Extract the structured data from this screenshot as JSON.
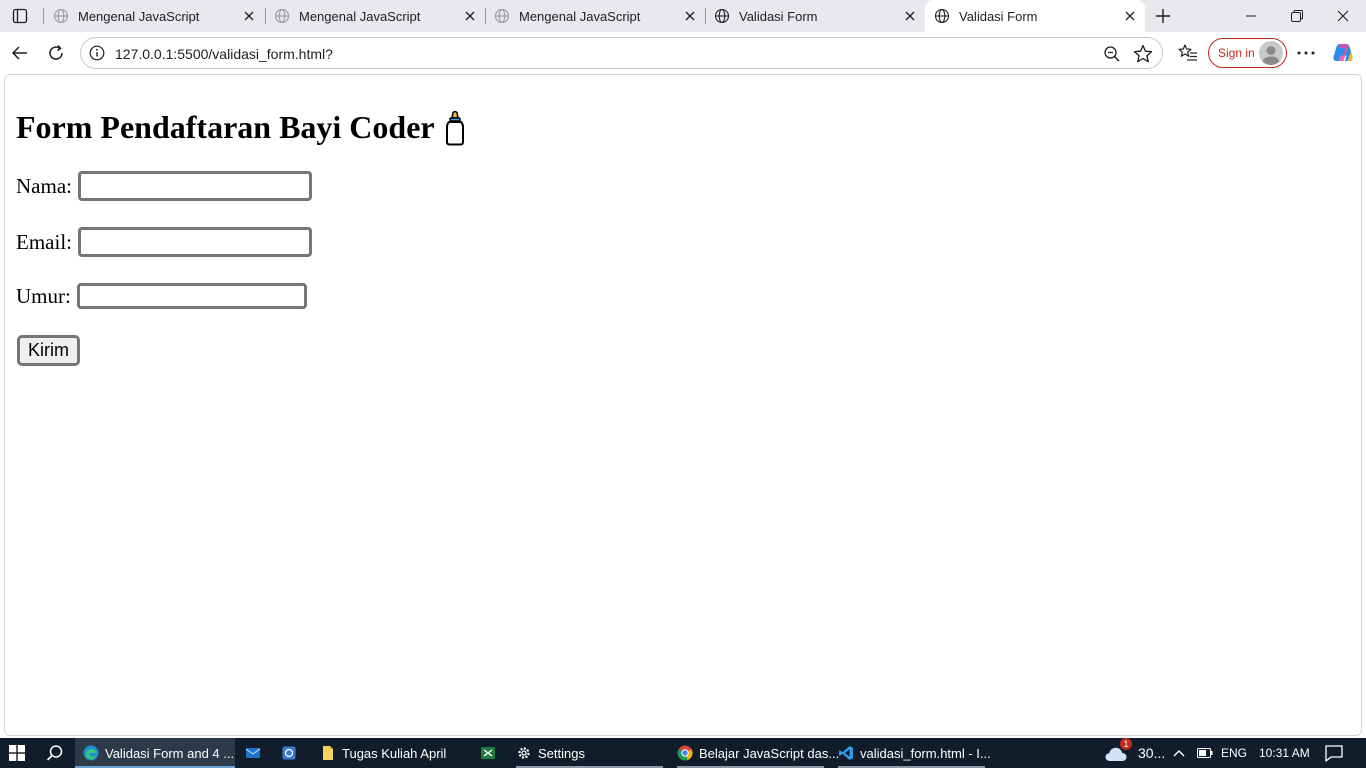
{
  "browser": {
    "tabs": [
      {
        "title": "Mengenal JavaScript",
        "active": false,
        "favicon": "globe-icon"
      },
      {
        "title": "Mengenal JavaScript",
        "active": false,
        "favicon": "globe-icon"
      },
      {
        "title": "Mengenal JavaScript",
        "active": false,
        "favicon": "globe-icon"
      },
      {
        "title": "Validasi Form",
        "active": false,
        "favicon": "globe-icon"
      },
      {
        "title": "Validasi Form",
        "active": true,
        "favicon": "globe-icon"
      }
    ],
    "address": {
      "url": "127.0.0.1:5500/validasi_form.html?"
    },
    "signin_label": "Sign in"
  },
  "page": {
    "title": "Form Pendaftaran Bayi Coder",
    "fields": {
      "nama": {
        "label": "Nama:",
        "value": ""
      },
      "email": {
        "label": "Email:",
        "value": ""
      },
      "umur": {
        "label": "Umur:",
        "value": ""
      }
    },
    "submit_label": "Kirim"
  },
  "taskbar": {
    "items": [
      {
        "label": "Validasi Form and 4 ...",
        "icon": "edge-icon"
      },
      {
        "label": "",
        "icon": "mail-icon"
      },
      {
        "label": "",
        "icon": "store-icon"
      },
      {
        "label": "Tugas Kuliah April",
        "icon": "folder-icon"
      },
      {
        "label": "",
        "icon": "spreadsheet-icon"
      },
      {
        "label": "Settings",
        "icon": "gear-icon"
      },
      {
        "label": "Belajar JavaScript das...",
        "icon": "chrome-icon"
      },
      {
        "label": "validasi_form.html - I...",
        "icon": "vscode-icon"
      }
    ],
    "weather": {
      "text": "30...",
      "badge": "1"
    },
    "language": "ENG",
    "time": "10:31 AM"
  },
  "colors": {
    "accent": "#c42b1c",
    "taskbar_bg": "#111d2a",
    "tabstrip_bg": "#e8e8ed"
  }
}
